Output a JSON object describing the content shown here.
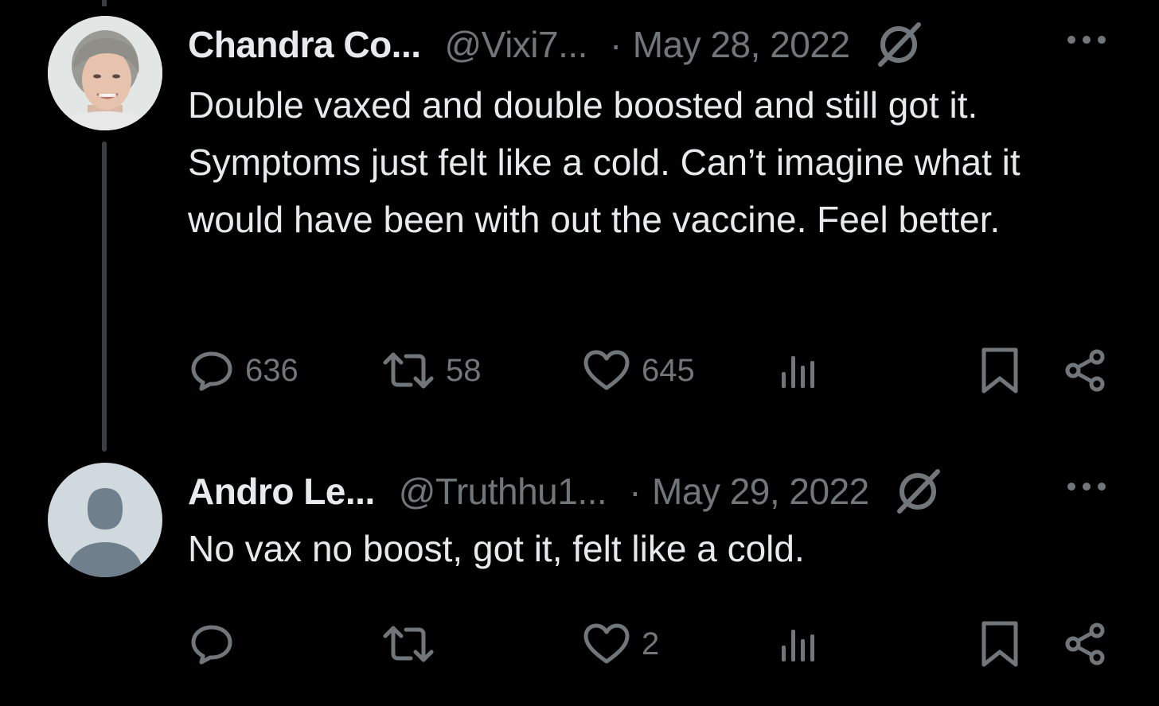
{
  "tweets": [
    {
      "author_name": "Chandra Co...",
      "handle": "@Vixi7...",
      "separator": "·",
      "date": "May 28, 2022",
      "text": "Double vaxed and double boosted and still got it. Symptoms just felt like a cold. Can’t imagine what it would have been with out the vaccine. Feel better.",
      "replies": "636",
      "reposts": "58",
      "likes": "645",
      "avatar": "photo-avatar"
    },
    {
      "author_name": "Andro Le...",
      "handle": "@Truthhu1...",
      "separator": "·",
      "date": "May 29, 2022",
      "text": "No vax no boost, got it, felt like a cold.",
      "replies": "",
      "reposts": "",
      "likes": "2",
      "avatar": "default-avatar"
    }
  ],
  "icons": {
    "reply": "reply-icon",
    "repost": "repost-icon",
    "like": "like-icon",
    "views": "views-icon",
    "bookmark": "bookmark-icon",
    "share": "share-icon",
    "more": "more-icon",
    "grok": "grok-icon"
  },
  "colors": {
    "background": "#000000",
    "primary_text": "#e7e9ea",
    "secondary_text": "#71767b",
    "thread_line": "#3a3d41"
  }
}
